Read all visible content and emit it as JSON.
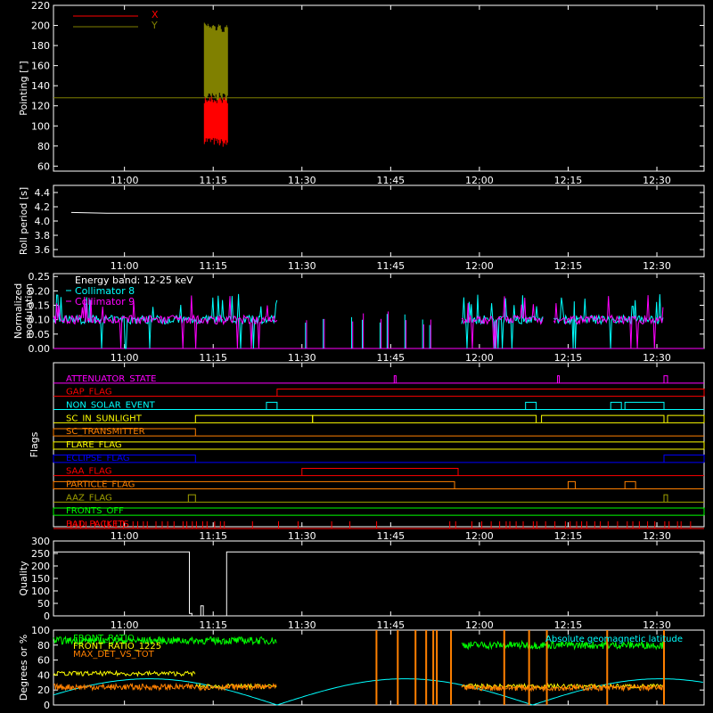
{
  "figure": {
    "background": "#000000",
    "foreground": "#ffffff",
    "x_axis": {
      "range_minutes": [
        10.8,
        12.633
      ],
      "tick_hours": [
        11.0,
        11.25,
        11.5,
        11.75,
        12.0,
        12.25,
        12.5
      ],
      "tick_labels": [
        "11:00",
        "11:15",
        "11:30",
        "11:45",
        "12:00",
        "12:15",
        "12:30"
      ]
    }
  },
  "chart_data": [
    {
      "id": "pointing",
      "type": "line",
      "ylabel": "Pointing [\"]",
      "ylim": [
        55,
        220
      ],
      "yticks": [
        60,
        80,
        100,
        120,
        140,
        160,
        180,
        200,
        220
      ],
      "legend": [
        "X",
        "Y"
      ],
      "legend_placement": "top-left",
      "series": [
        {
          "name": "X",
          "color": "#ff0000",
          "x_range": [
            11.225,
            11.292
          ],
          "band": [
            78,
            130
          ]
        },
        {
          "name": "Y",
          "color": "#808000",
          "x_range": [
            11.225,
            11.292
          ],
          "band": [
            125,
            200
          ]
        }
      ],
      "reference_line": {
        "y": 128,
        "color": "#808000"
      }
    },
    {
      "id": "roll-period",
      "type": "line",
      "ylabel": "Roll period [s]",
      "ylim": [
        3.5,
        4.5
      ],
      "yticks": [
        3.6,
        3.8,
        4.0,
        4.2,
        4.4
      ],
      "series": [
        {
          "color": "#ffffff",
          "x": [
            10.85,
            10.95,
            12.633
          ],
          "y": [
            4.12,
            4.11,
            4.11
          ]
        }
      ]
    },
    {
      "id": "modulation",
      "type": "line",
      "ylabel": "Normalized modulation",
      "ylim": [
        0,
        0.26
      ],
      "yticks": [
        0.0,
        0.05,
        0.1,
        0.15,
        0.2,
        0.25
      ],
      "annotation": "Energy band: 12-25 keV",
      "legend": [
        "Collimator 8",
        "Collimator 9"
      ],
      "legend_colors": [
        "#00ffff",
        "#ff00ff"
      ],
      "active_ranges": [
        [
          10.8,
          11.43
        ],
        [
          11.95,
          12.18
        ],
        [
          12.21,
          12.52
        ]
      ],
      "baseline": 0.1
    },
    {
      "id": "flags",
      "type": "step",
      "ylabel": "Flags",
      "flags": [
        {
          "name": "ATTENUATOR_STATE",
          "color": "#ff00ff"
        },
        {
          "name": "GAP_FLAG",
          "color": "#ff0000"
        },
        {
          "name": "NON_SOLAR_EVENT",
          "color": "#00ffff"
        },
        {
          "name": "SC_IN_SUNLIGHT",
          "color": "#ffff00"
        },
        {
          "name": "SC_TRANSMITTER",
          "color": "#ff8000"
        },
        {
          "name": "FLARE_FLAG",
          "color": "#ffff00"
        },
        {
          "name": "ECLIPSE_FLAG",
          "color": "#0000ff"
        },
        {
          "name": "SAA_FLAG",
          "color": "#ff0000"
        },
        {
          "name": "PARTICLE_FLAG",
          "color": "#ff8000"
        },
        {
          "name": "AAZ_FLAG",
          "color": "#a0a000"
        },
        {
          "name": "FRONTS_OFF",
          "color": "#00ff00"
        },
        {
          "name": "BAD_PACKETS",
          "color": "#ff0000"
        }
      ]
    },
    {
      "id": "quality",
      "type": "line",
      "ylabel": "Quality",
      "ylim": [
        0,
        300
      ],
      "yticks": [
        0,
        50,
        100,
        150,
        200,
        250,
        300
      ],
      "series": [
        {
          "color": "#ffffff",
          "x": [
            10.8,
            11.183,
            11.183,
            11.19,
            11.19,
            11.215,
            11.215,
            11.222,
            11.222,
            11.233,
            11.233,
            11.28,
            11.28,
            11.288,
            11.288,
            12.633
          ],
          "y": [
            256,
            256,
            10,
            10,
            0,
            0,
            40,
            40,
            0,
            0,
            0,
            0,
            0,
            0,
            256,
            256
          ]
        }
      ]
    },
    {
      "id": "orbit",
      "type": "line",
      "ylabel": "Degrees or %",
      "ylim": [
        0,
        100
      ],
      "yticks": [
        0,
        20,
        40,
        60,
        80,
        100
      ],
      "legend": [
        "FRONT_RATIO",
        "FRONT_RATIO_1225",
        "MAX_DET_VS_TOT"
      ],
      "legend_colors": [
        "#00ff00",
        "#ffff00",
        "#ff8000"
      ],
      "right_label": "Absolute geomagnetic latitude",
      "right_label_color": "#00ffff"
    }
  ]
}
